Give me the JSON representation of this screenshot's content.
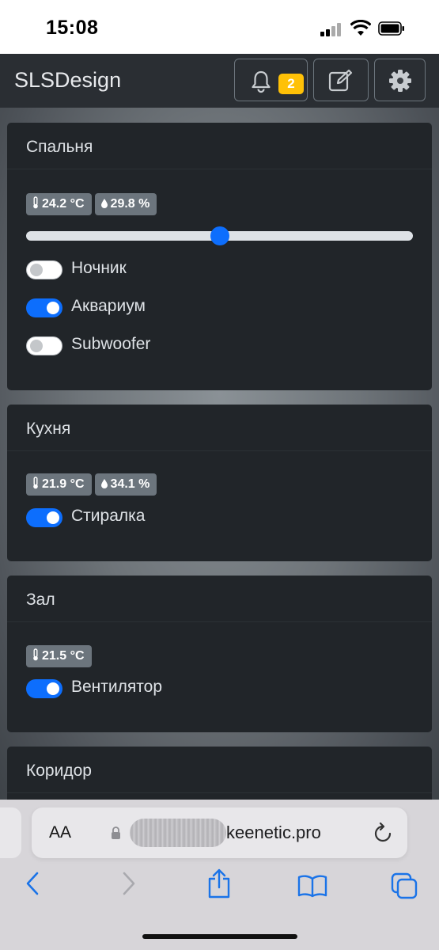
{
  "status_bar": {
    "time": "15:08"
  },
  "app": {
    "brand": "SLSDesign",
    "notifications_count": "2",
    "nav_icons": [
      "bell-icon",
      "edit-icon",
      "gear-icon"
    ]
  },
  "rooms": [
    {
      "name": "Спальня",
      "temperature": "24.2 °C",
      "humidity": "29.8 %",
      "slider_value_fraction": 0.5,
      "switches": [
        {
          "label": "Ночник",
          "on": false
        },
        {
          "label": "Аквариум",
          "on": true
        },
        {
          "label": "Subwoofer",
          "on": false
        }
      ]
    },
    {
      "name": "Кухня",
      "temperature": "21.9 °C",
      "humidity": "34.1 %",
      "switches": [
        {
          "label": "Стиралка",
          "on": true
        }
      ]
    },
    {
      "name": "Зал",
      "temperature": "21.5 °C",
      "switches": [
        {
          "label": "Вентилятор",
          "on": true
        }
      ]
    },
    {
      "name": "Коридор"
    }
  ],
  "browser": {
    "aa_label": "AA",
    "url_domain": "keenetic.pro",
    "toolbar_icons": [
      "back-icon",
      "forward-icon",
      "share-icon",
      "bookmarks-icon",
      "tabs-icon"
    ]
  },
  "colors": {
    "accent": "#0d6efd",
    "badge_warning": "#ffc107",
    "card_bg": "#212529"
  }
}
